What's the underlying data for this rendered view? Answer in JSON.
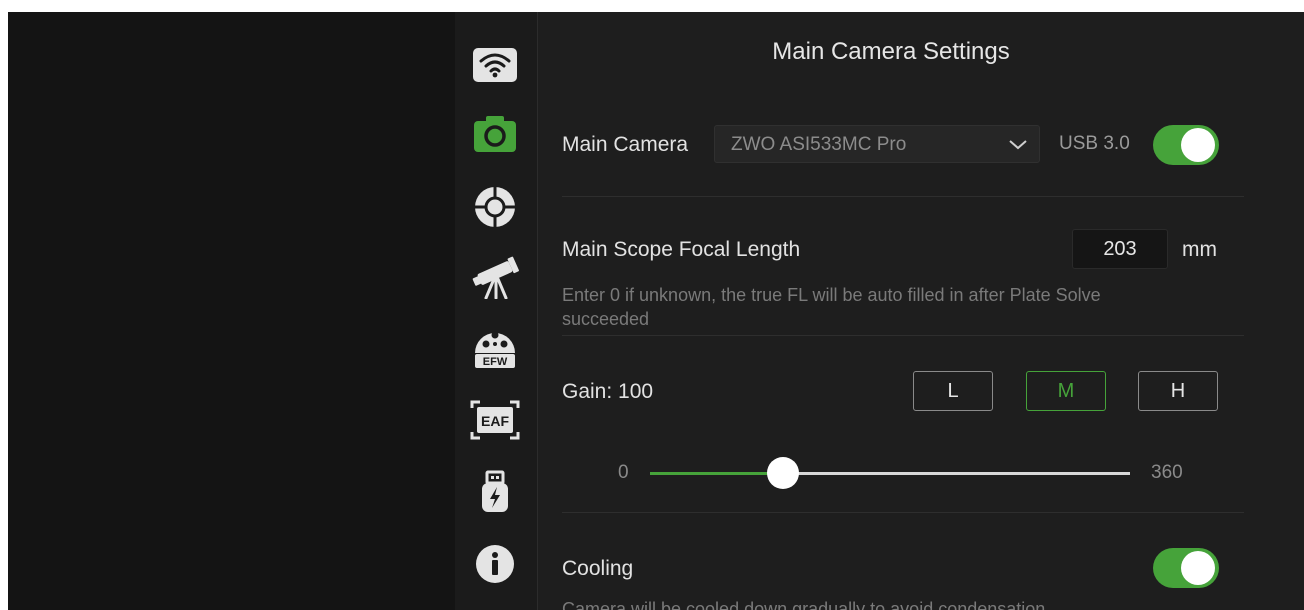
{
  "sidebar": {
    "items": [
      {
        "icon": "wifi-icon",
        "active": false
      },
      {
        "icon": "camera-icon",
        "active": true
      },
      {
        "icon": "guide-crosshair-icon",
        "active": false
      },
      {
        "icon": "telescope-icon",
        "active": false
      },
      {
        "icon": "filter-wheel-icon",
        "label": "EFW",
        "active": false
      },
      {
        "icon": "focuser-icon",
        "label": "EAF",
        "active": false
      },
      {
        "icon": "usb-power-icon",
        "active": false
      },
      {
        "icon": "info-icon",
        "active": false
      }
    ]
  },
  "panel": {
    "title": "Main Camera Settings",
    "camera": {
      "label": "Main Camera",
      "selected": "ZWO ASI533MC Pro",
      "usb_label": "USB 3.0",
      "usb_enabled": true
    },
    "focal_length": {
      "label": "Main Scope Focal Length",
      "value": "203",
      "unit": "mm",
      "hint": "Enter 0 if unknown, the true FL will be auto filled in after Plate Solve succeeded"
    },
    "gain": {
      "label": "Gain: 100",
      "value": 100,
      "min_label": "0",
      "max_label": "360",
      "min": 0,
      "max": 360,
      "presets": [
        "L",
        "M",
        "H"
      ],
      "active_preset": "M"
    },
    "cooling": {
      "label": "Cooling",
      "enabled": true,
      "hint": "Camera will be cooled down gradually to avoid condensation"
    }
  },
  "colors": {
    "accent": "#46a33a",
    "background": "#1e1e1e",
    "sidebar": "#1b1b1b"
  }
}
